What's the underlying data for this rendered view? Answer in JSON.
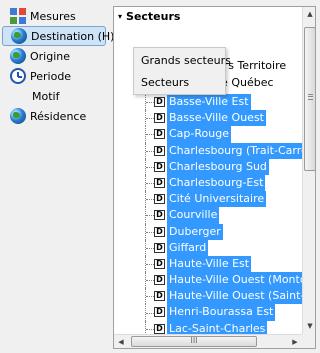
{
  "nav": {
    "items": [
      {
        "label": "Mesures",
        "icon": "grid-icon"
      },
      {
        "label": "Destination (H)",
        "icon": "globe-icon",
        "selected": true
      },
      {
        "label": "Origine",
        "icon": "globe-icon"
      },
      {
        "label": "Periode",
        "icon": "clock-icon"
      },
      {
        "label": "Motif",
        "icon": ""
      },
      {
        "label": "Résidence",
        "icon": "globe-icon"
      }
    ]
  },
  "tree": {
    "header": "Secteurs",
    "header_arrow": "▾",
    "behind_texts": [
      "hors Territoire",
      "le Québec"
    ],
    "node_glyph": "D",
    "rows": [
      "Basse-Ville Est",
      "Basse-Ville Ouest",
      "Cap-Rouge",
      "Charlesbourg (Trait-Carré)",
      "Charlesbourg Sud",
      "Charlesbourg-Est",
      "Cité Universitaire",
      "Courville",
      "Duberger",
      "Giffard",
      "Haute-Ville Est",
      "Haute-Ville Ouest  (Montcal",
      "Haute-Ville Ouest  (Saint-Sa",
      "Henri-Bourassa Est",
      "Lac-Saint-Charles"
    ]
  },
  "popup": {
    "items": [
      "Grands secteurs",
      "Secteurs"
    ]
  },
  "scrollbars": {
    "up": "▲",
    "down": "▼",
    "left": "◀",
    "right": "▶",
    "h_grip": "III"
  },
  "colors": {
    "selection": "#3399ff",
    "nav_selected": "#cfe3f7"
  }
}
